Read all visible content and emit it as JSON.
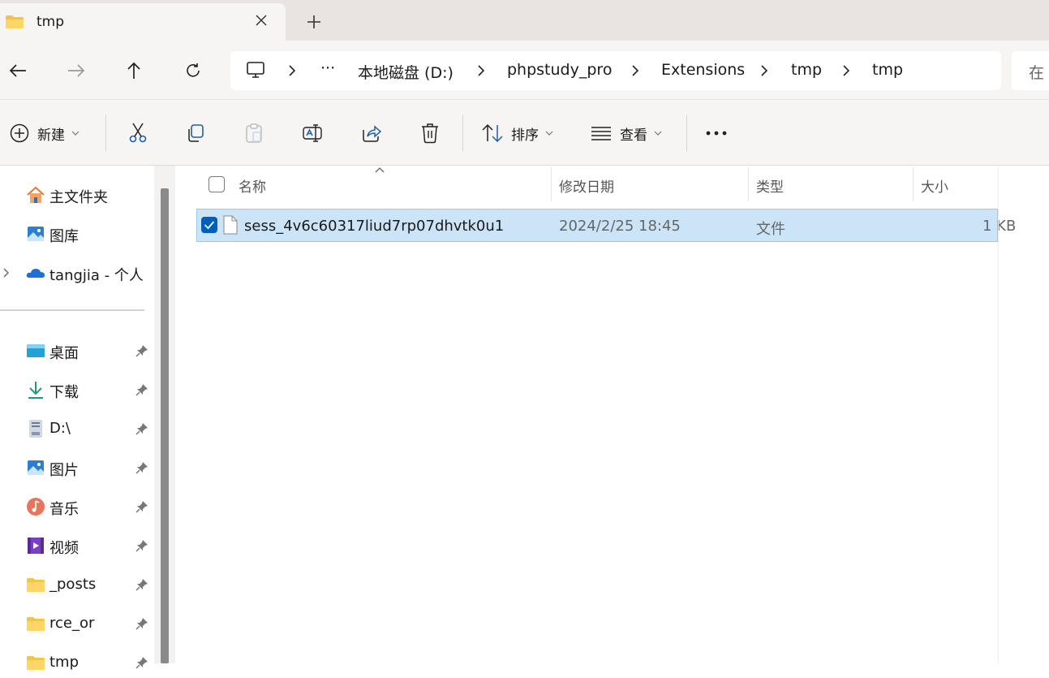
{
  "tab": {
    "title": "tmp"
  },
  "breadcrumb": {
    "overflow": "···",
    "segments": [
      "本地磁盘 (D:)",
      "phpstudy_pro",
      "Extensions",
      "tmp",
      "tmp"
    ]
  },
  "search": {
    "placeholder": "在"
  },
  "toolbar": {
    "new_label": "新建",
    "sort_label": "排序",
    "view_label": "查看",
    "more_label": "···"
  },
  "sidebar": {
    "quick": [
      {
        "label": "主文件夹",
        "icon": "home-icon"
      },
      {
        "label": "图库",
        "icon": "gallery-icon"
      },
      {
        "label": "tangjia - 个人",
        "icon": "onedrive-icon"
      }
    ],
    "pinned": [
      {
        "label": "桌面",
        "icon": "desktop-icon"
      },
      {
        "label": "下载",
        "icon": "download-icon"
      },
      {
        "label": "D:\\",
        "icon": "drive-icon"
      },
      {
        "label": "图片",
        "icon": "pictures-icon"
      },
      {
        "label": "音乐",
        "icon": "music-icon"
      },
      {
        "label": "视频",
        "icon": "videos-icon"
      },
      {
        "label": "_posts",
        "icon": "folder-icon"
      },
      {
        "label": "rce_or",
        "icon": "folder-icon"
      },
      {
        "label": "tmp",
        "icon": "folder-icon"
      }
    ]
  },
  "columns": {
    "name": "名称",
    "modified": "修改日期",
    "type": "类型",
    "size": "大小"
  },
  "files": [
    {
      "name": "sess_4v6c60317liud7rp07dhvtk0u1",
      "modified": "2024/2/25 18:45",
      "type": "文件",
      "size": "1 KB",
      "selected": true
    }
  ],
  "colors": {
    "accent": "#005fb8",
    "selection": "#cce4f7",
    "folder": "#f5c34a"
  }
}
